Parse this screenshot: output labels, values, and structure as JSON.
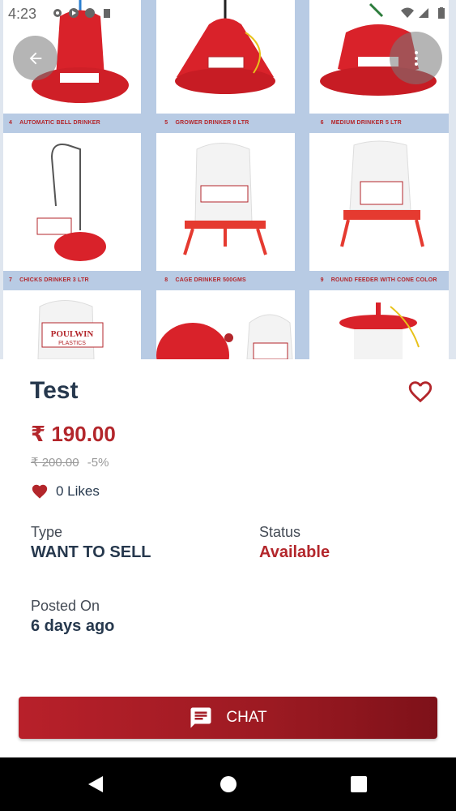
{
  "status_bar": {
    "time": "4:23"
  },
  "gallery": {
    "captions": [
      {
        "no": "4",
        "text": "Automatic Bell Drinker"
      },
      {
        "no": "5",
        "text": "Grower Drinker 8 Ltr"
      },
      {
        "no": "6",
        "text": "Medium Drinker 5 Ltr"
      },
      {
        "no": "7",
        "text": "Chicks Drinker 3 Ltr"
      },
      {
        "no": "8",
        "text": "Cage Drinker 500Gms"
      },
      {
        "no": "9",
        "text": "Round Feeder with Cone Color"
      }
    ],
    "brand_logo_text": "POULWIN",
    "brand_logo_sub": "PLASTICS"
  },
  "product": {
    "title": "Test",
    "price": "₹ 190.00",
    "original_price": "₹ 200.00",
    "discount": "-5%",
    "likes": "0 Likes"
  },
  "details": {
    "type_label": "Type",
    "type_value": "WANT TO SELL",
    "status_label": "Status",
    "status_value": "Available",
    "posted_label": "Posted On",
    "posted_value": "6 days ago"
  },
  "chat_button": {
    "label": "CHAT"
  },
  "colors": {
    "accent": "#b3262b",
    "navy": "#26384d"
  }
}
